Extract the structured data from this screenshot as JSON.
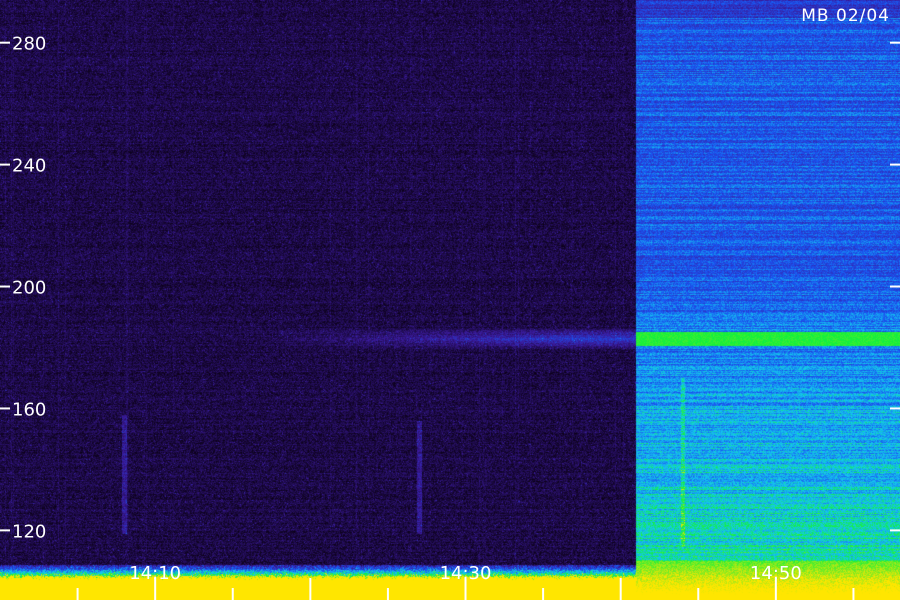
{
  "chart_data": {
    "type": "heatmap",
    "title": "",
    "corner_label": "MB 02/04",
    "xlabel": "",
    "ylabel": "",
    "y_ticks": [
      {
        "value": 280,
        "label": "280"
      },
      {
        "value": 240,
        "label": "240"
      },
      {
        "value": 200,
        "label": "200"
      },
      {
        "value": 160,
        "label": "160"
      },
      {
        "value": 120,
        "label": "120"
      }
    ],
    "ylim": [
      107,
      294
    ],
    "x_ticks": [
      {
        "value": "14:10",
        "label": "14:10"
      },
      {
        "value": "14:30",
        "label": "14:30"
      },
      {
        "value": "14:50",
        "label": "14:50"
      }
    ],
    "xlim": [
      "14:00",
      "14:58"
    ],
    "minor_tick_interval_minutes": 5,
    "regions": [
      {
        "name": "quiet",
        "from": "14:00",
        "to": "14:41",
        "level": "low"
      },
      {
        "name": "active",
        "from": "14:41",
        "to": "14:58",
        "level": "high"
      }
    ],
    "features": [
      {
        "kind": "horizontal-band",
        "y": 183,
        "from": "14:24",
        "to": "14:58",
        "note": ""
      },
      {
        "kind": "vertical-streak",
        "x": "14:08",
        "y_range": [
          119,
          158
        ]
      },
      {
        "kind": "vertical-streak",
        "x": "14:27",
        "y_range": [
          119,
          156
        ]
      },
      {
        "kind": "vertical-streak",
        "x": "14:44",
        "y_range": [
          115,
          170
        ]
      }
    ],
    "colors": {
      "background_low": "#0a0014",
      "low_purple": "#3a1a9a",
      "mid_blue": "#1a52f0",
      "cyan": "#14c8f0",
      "green": "#12f03c",
      "yellow": "#ffe600",
      "label": "#ffffff"
    }
  }
}
